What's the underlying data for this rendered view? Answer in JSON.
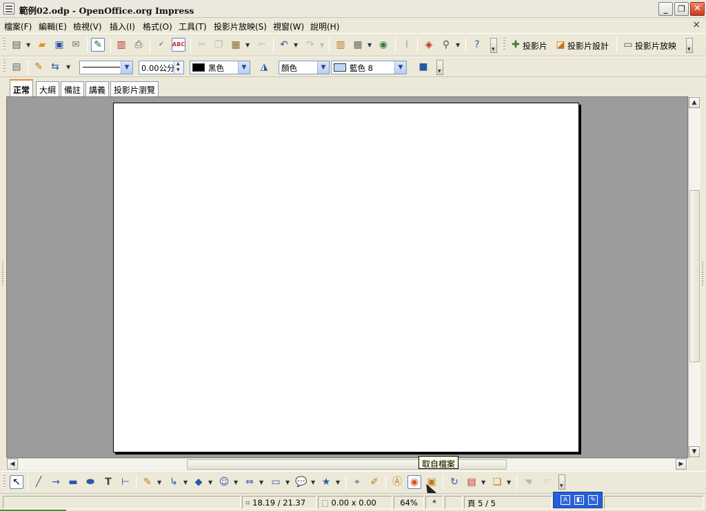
{
  "window": {
    "title": "範例02.odp - OpenOffice.org Impress",
    "minimize_glyph": "_",
    "restore_glyph": "❐",
    "close_glyph": "✕"
  },
  "menu": {
    "items": [
      "檔案(F)",
      "編輯(E)",
      "檢視(V)",
      "插入(I)",
      "格式(O)",
      "工具(T)",
      "投影片放映(S)",
      "視窗(W)",
      "說明(H)"
    ],
    "close_glyph": "×"
  },
  "toolbar1": {
    "slide_label": "投影片",
    "slide_design_label": "投影片設計",
    "slide_show_label": "投影片放映"
  },
  "toolbar2": {
    "line_width_value": "0.00公分",
    "line_color": {
      "label": "黑色",
      "swatch": "#000000"
    },
    "area_style": "顏色",
    "area_color": {
      "label": "藍色 8",
      "swatch": "#bcd8f8"
    }
  },
  "tabs": [
    "正常",
    "大綱",
    "備註",
    "講義",
    "投影片瀏覽"
  ],
  "tooltip": {
    "text": "取自檔案"
  },
  "status": {
    "position": "18.19 / 21.37",
    "size": "0.00 x 0.00",
    "zoom": "64%",
    "modified": "*",
    "page": "頁 5 / 5"
  }
}
